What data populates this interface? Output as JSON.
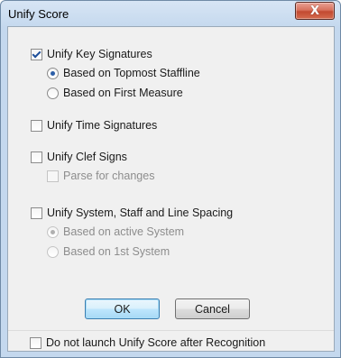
{
  "window": {
    "title": "Unify Score",
    "close_label": "X"
  },
  "options": {
    "unify_key_signatures": {
      "label": "Unify Key Signatures",
      "checked": true,
      "choices": [
        {
          "label": "Based on Topmost Staffline",
          "selected": true
        },
        {
          "label": "Based on First Measure",
          "selected": false
        }
      ]
    },
    "unify_time_signatures": {
      "label": "Unify Time Signatures",
      "checked": false
    },
    "unify_clef_signs": {
      "label": "Unify Clef Signs",
      "checked": false,
      "parse_for_changes": {
        "label": "Parse for changes",
        "checked": false,
        "enabled": false
      }
    },
    "unify_spacing": {
      "label": "Unify System, Staff and Line Spacing",
      "checked": false,
      "choices": [
        {
          "label": "Based on active System",
          "selected": true,
          "enabled": false
        },
        {
          "label": "Based on 1st System",
          "selected": false,
          "enabled": false
        }
      ]
    }
  },
  "buttons": {
    "ok": "OK",
    "cancel": "Cancel"
  },
  "footer": {
    "do_not_launch": {
      "label": "Do not launch Unify Score after Recognition",
      "checked": false
    }
  }
}
